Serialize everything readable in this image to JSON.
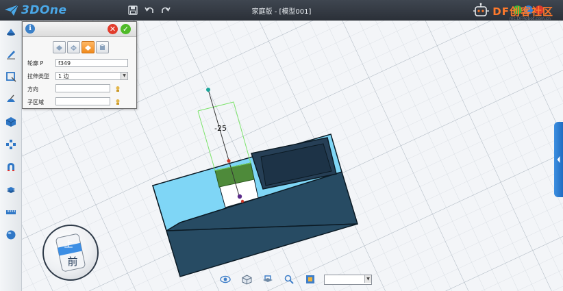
{
  "app": {
    "logo_text": "3DOne",
    "document_title": "家庭版 - [模型001]",
    "watermark": {
      "brand": "DF创客社区",
      "url": "mc.DFRobot.com.cn"
    }
  },
  "quick_access": [
    "save-icon",
    "undo-icon",
    "redo-icon"
  ],
  "left_toolbar": [
    "basic-shapes-icon",
    "sketch-icon",
    "sketch-edit-icon",
    "special-features-icon",
    "feature-modify-icon",
    "pattern-icon",
    "combine-icon",
    "assembly-icon",
    "measure-icon",
    "material-sphere-icon"
  ],
  "panel": {
    "modes": [
      "extrude-mode-1",
      "extrude-mode-2",
      "extrude-mode-3",
      "extrude-mode-4"
    ],
    "active_mode_index": 2,
    "rows": [
      {
        "label": "轮廓 P",
        "value": "f349"
      },
      {
        "label": "拉伸类型",
        "value": "1 边"
      },
      {
        "label": "方向",
        "value": ""
      },
      {
        "label": "子区域",
        "value": ""
      }
    ]
  },
  "scene": {
    "dimension_label": "-25"
  },
  "viewcube": {
    "top_face": "上",
    "front_face": "前"
  },
  "bottom_toolbar": [
    "display-icon",
    "view-cube-icon",
    "render-mode-icon",
    "zoom-icon",
    "view-layout-icon"
  ],
  "bottom_combo_value": "",
  "colors": {
    "accent": "#3b8be0",
    "face_top": "#7fd6f6",
    "face_side": "#274b63",
    "selection": "#4e8a3a"
  }
}
